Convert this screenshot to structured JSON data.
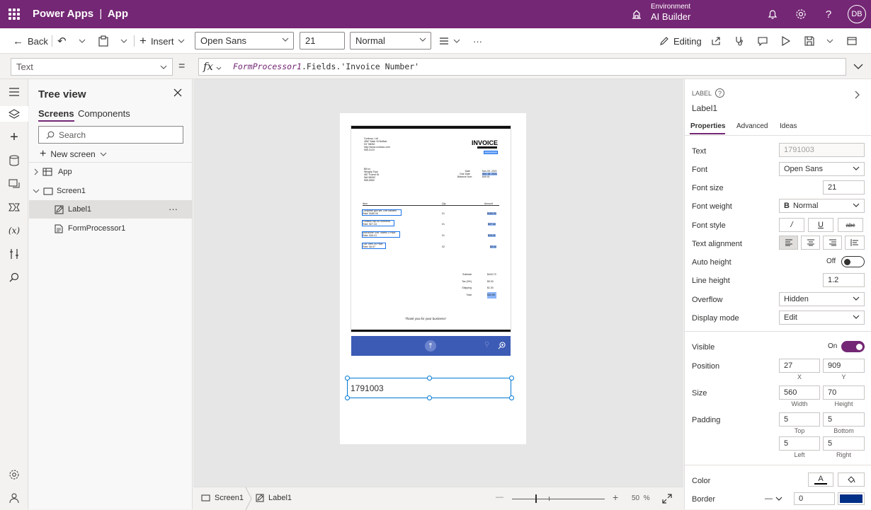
{
  "app": {
    "brand": "Power Apps",
    "separator": "|",
    "name": "App"
  },
  "environment": {
    "label": "Environment",
    "name": "AI Builder"
  },
  "user": {
    "initials": "DB"
  },
  "command_bar": {
    "back": "Back",
    "insert": "Insert",
    "font": "Open Sans",
    "font_size": "21",
    "font_weight": "Normal",
    "more": "···",
    "editing": "Editing"
  },
  "formula_bar": {
    "property": "Text",
    "equals": "=",
    "fx": "fx",
    "formula_control": "FormProcessor1",
    "formula_rest": ".Fields.'Invoice Number'"
  },
  "tree": {
    "title": "Tree view",
    "tabs": [
      "Screens",
      "Components"
    ],
    "search_placeholder": "Search",
    "new_screen": "New screen",
    "items": [
      {
        "label": "App"
      },
      {
        "label": "Screen1"
      },
      {
        "label": "Label1"
      },
      {
        "label": "FormProcessor1"
      }
    ],
    "more": "···"
  },
  "canvas": {
    "invoice": {
      "company": [
        "Contoso, Ltd",
        "4567 Main St Buffalo",
        "NY 98052",
        "http://www.contoso.com",
        "555-0123"
      ],
      "title": "INVOICE",
      "bill_to": [
        "Bill to:",
        "Wingtip Toys",
        "987 Forest St",
        "WA 98052",
        "555-5552"
      ],
      "date_labels": [
        "Date",
        "Due Date",
        "Balance Due:"
      ],
      "date_values": [
        "Nov 03, 2021",
        "Nov 18, 2021",
        "$49.91"
      ],
      "headers": [
        "Item",
        "Qty",
        "Amount"
      ],
      "lines": [
        {
          "item": "Complete golf set, Left handed",
          "rate": "Rate: $180.00",
          "qty": "01",
          "amount": "$180.00"
        },
        {
          "item": "Portable clip-on umbrella",
          "rate": "Rate: $27.44",
          "qty": "01",
          "amount": "$27.44"
        },
        {
          "item": "MicroNine Golf Towels 3 Pack",
          "rate": "Rate: $16.41",
          "qty": "01",
          "amount": "$16.41"
        },
        {
          "item": "Golf Tees 25 Pack",
          "rate": "Rate: $4.67",
          "qty": "02",
          "amount": "$9.34"
        }
      ],
      "totals_labels": [
        "Subtotal",
        "Tax (0%)",
        "Shipping",
        "Total"
      ],
      "totals_values": [
        "$443.70",
        "$0.00",
        "$1.00",
        "$44.96"
      ],
      "footer": "Thank you for your business!"
    },
    "label_value": "1791003"
  },
  "status_bar": {
    "screen": "Screen1",
    "control": "Label1",
    "zoom": "50",
    "zoom_unit": "%",
    "zoom_minus": "—",
    "zoom_plus": "+"
  },
  "properties": {
    "type": "LABEL",
    "name": "Label1",
    "tabs": [
      "Properties",
      "Advanced",
      "Ideas"
    ],
    "rows": {
      "text": {
        "label": "Text",
        "value": "1791003"
      },
      "font": {
        "label": "Font",
        "value": "Open Sans"
      },
      "font_size": {
        "label": "Font size",
        "value": "21"
      },
      "font_weight": {
        "label": "Font weight",
        "value": "Normal",
        "prefix": "B"
      },
      "font_style": {
        "label": "Font style"
      },
      "text_alignment": {
        "label": "Text alignment"
      },
      "auto_height": {
        "label": "Auto height",
        "value": "Off"
      },
      "line_height": {
        "label": "Line height",
        "value": "1.2"
      },
      "overflow": {
        "label": "Overflow",
        "value": "Hidden"
      },
      "display_mode": {
        "label": "Display mode",
        "value": "Edit"
      },
      "visible": {
        "label": "Visible",
        "value": "On"
      },
      "position": {
        "label": "Position",
        "x": "27",
        "y": "909",
        "x_label": "X",
        "y_label": "Y"
      },
      "size": {
        "label": "Size",
        "width": "560",
        "height": "70",
        "w_label": "Width",
        "h_label": "Height"
      },
      "padding": {
        "label": "Padding",
        "top": "5",
        "bottom": "5",
        "left": "5",
        "right": "5",
        "top_label": "Top",
        "bottom_label": "Bottom",
        "left_label": "Left",
        "right_label": "Right"
      },
      "color": {
        "label": "Color",
        "text_glyph": "A"
      },
      "border": {
        "label": "Border",
        "width": "0",
        "style_glyph": "—"
      }
    }
  },
  "colors": {
    "brand": "#742774",
    "selection": "#0078d4",
    "border_swatch": "#002f87"
  }
}
